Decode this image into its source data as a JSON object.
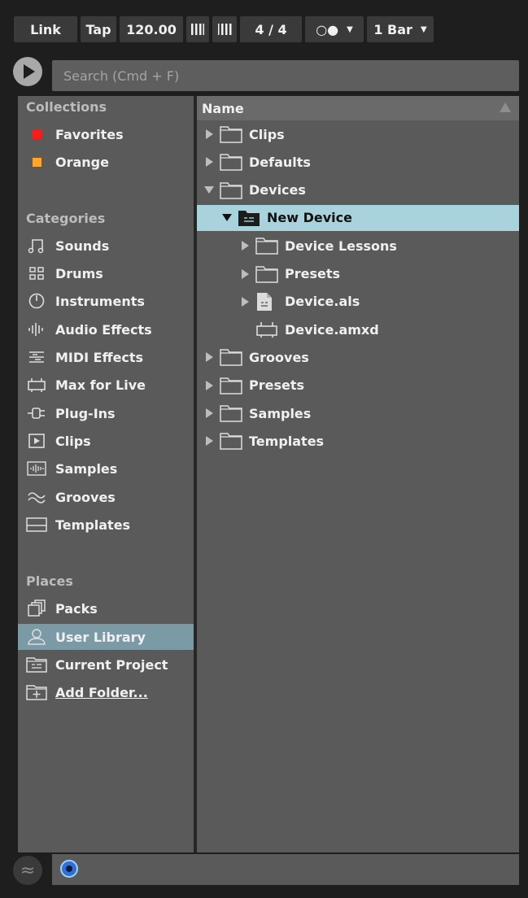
{
  "transport": {
    "link": "Link",
    "tap": "Tap",
    "tempo": "120.00",
    "nudge_down": "||||",
    "nudge_up": "||||",
    "time_sig": "4 / 4",
    "metronome": "○●",
    "quantize": "1 Bar"
  },
  "search": {
    "placeholder": "Search (Cmd + F)"
  },
  "sidebar": {
    "collections_title": "Collections",
    "collections": [
      {
        "label": "Favorites",
        "color": "#ff1a1a"
      },
      {
        "label": "Orange",
        "color": "#ffa52b"
      }
    ],
    "categories_title": "Categories",
    "categories": [
      {
        "label": "Sounds",
        "icon": "music-note-icon"
      },
      {
        "label": "Drums",
        "icon": "drum-grid-icon"
      },
      {
        "label": "Instruments",
        "icon": "knob-icon"
      },
      {
        "label": "Audio Effects",
        "icon": "audio-bars-icon"
      },
      {
        "label": "MIDI Effects",
        "icon": "midi-lines-icon"
      },
      {
        "label": "Max for Live",
        "icon": "max-device-icon"
      },
      {
        "label": "Plug-Ins",
        "icon": "plug-icon"
      },
      {
        "label": "Clips",
        "icon": "clip-play-icon"
      },
      {
        "label": "Samples",
        "icon": "waveform-icon"
      },
      {
        "label": "Grooves",
        "icon": "groove-wave-icon"
      },
      {
        "label": "Templates",
        "icon": "template-icon"
      }
    ],
    "places_title": "Places",
    "places": [
      {
        "label": "Packs",
        "icon": "packs-icon"
      },
      {
        "label": "User Library",
        "icon": "user-icon",
        "selected": true
      },
      {
        "label": "Current Project",
        "icon": "project-folder-icon"
      },
      {
        "label": "Add Folder...",
        "icon": "add-folder-icon"
      }
    ]
  },
  "browser": {
    "column_header": "Name",
    "items": [
      {
        "label": "Clips",
        "level": 0,
        "expander": "collapsed",
        "icon": "folder-icon"
      },
      {
        "label": "Defaults",
        "level": 0,
        "expander": "collapsed",
        "icon": "folder-icon"
      },
      {
        "label": "Devices",
        "level": 0,
        "expander": "expanded",
        "icon": "folder-icon"
      },
      {
        "label": "New Device",
        "level": 1,
        "expander": "expanded",
        "icon": "project-folder-icon",
        "selected": true
      },
      {
        "label": "Device Lessons",
        "level": 2,
        "expander": "collapsed",
        "icon": "folder-icon"
      },
      {
        "label": "Presets",
        "level": 2,
        "expander": "collapsed",
        "icon": "folder-icon"
      },
      {
        "label": "Device.als",
        "level": 2,
        "expander": "collapsed",
        "icon": "als-file-icon"
      },
      {
        "label": "Device.amxd",
        "level": 2,
        "expander": "none",
        "icon": "max-device-icon"
      },
      {
        "label": "Grooves",
        "level": 0,
        "expander": "collapsed",
        "icon": "folder-icon"
      },
      {
        "label": "Presets",
        "level": 0,
        "expander": "collapsed",
        "icon": "folder-icon"
      },
      {
        "label": "Samples",
        "level": 0,
        "expander": "collapsed",
        "icon": "folder-icon"
      },
      {
        "label": "Templates",
        "level": 0,
        "expander": "collapsed",
        "icon": "folder-icon"
      }
    ]
  }
}
